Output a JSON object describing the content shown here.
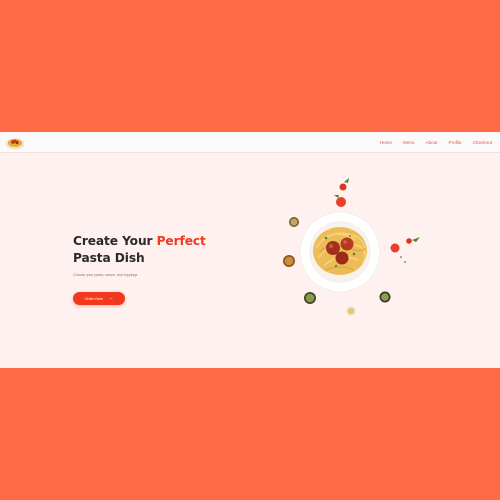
{
  "nav": {
    "logo_icon": "pasta-bowl-icon",
    "links": [
      "Home",
      "Menu",
      "About",
      "Profile",
      "Checkout"
    ]
  },
  "hero": {
    "title_part1": "Create Your ",
    "title_accent": "Perfect",
    "title_line2": "Pasta Dish",
    "subtitle": "Choose your pasta, sauce, and toppings",
    "cta_label": "Order Now",
    "cta_icon": "arrow-right-icon"
  },
  "colors": {
    "background": "#FF6B45",
    "page": "#FEF1F0",
    "accent": "#F2391D",
    "heading": "#2A2A2A"
  }
}
